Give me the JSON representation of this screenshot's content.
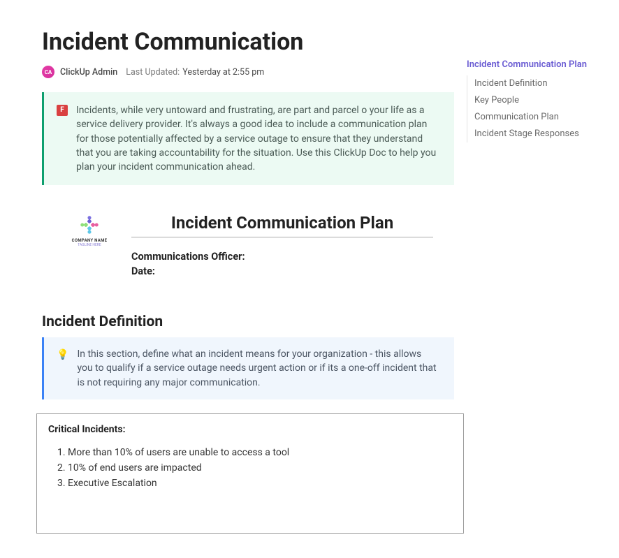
{
  "header": {
    "title": "Incident Communication",
    "avatar_initials": "CA",
    "author": "ClickUp Admin",
    "updated_label": "Last Updated:",
    "updated_time": "Yesterday at 2:55 pm"
  },
  "callout": {
    "icon_name": "pin-icon",
    "icon_glyph": "F",
    "text": "Incidents, while very untoward and frustrating, are part and parcel o your life as a service delivery provider. It's always a good idea to include a communication plan for those potentially affected by a service outage to ensure that they understand that you are taking accountability for the situation. Use this ClickUp Doc to help you plan your incident communication ahead."
  },
  "plan": {
    "logo_company": "COMPANY NAME",
    "logo_tagline": "TAGLINE HERE",
    "title": "Incident Communication Plan",
    "field_officer_label": "Communications Officer:",
    "field_date_label": "Date:"
  },
  "section_definition": {
    "heading": "Incident Definition",
    "tip_icon": "💡",
    "tip_text": "In this section, define what an incident means for your organization - this allows you to qualify if a service outage needs urgent action or if its a one-off incident that is not requiring any major communication."
  },
  "critical": {
    "title": "Critical Incidents:",
    "items": [
      "More than 10% of users are unable to access a tool",
      "10% of end users are impacted",
      "Executive Escalation"
    ]
  },
  "toc": {
    "title": "Incident Communication Plan",
    "items": [
      "Incident Definition",
      "Key People",
      "Communication Plan",
      "Incident Stage Responses"
    ]
  }
}
